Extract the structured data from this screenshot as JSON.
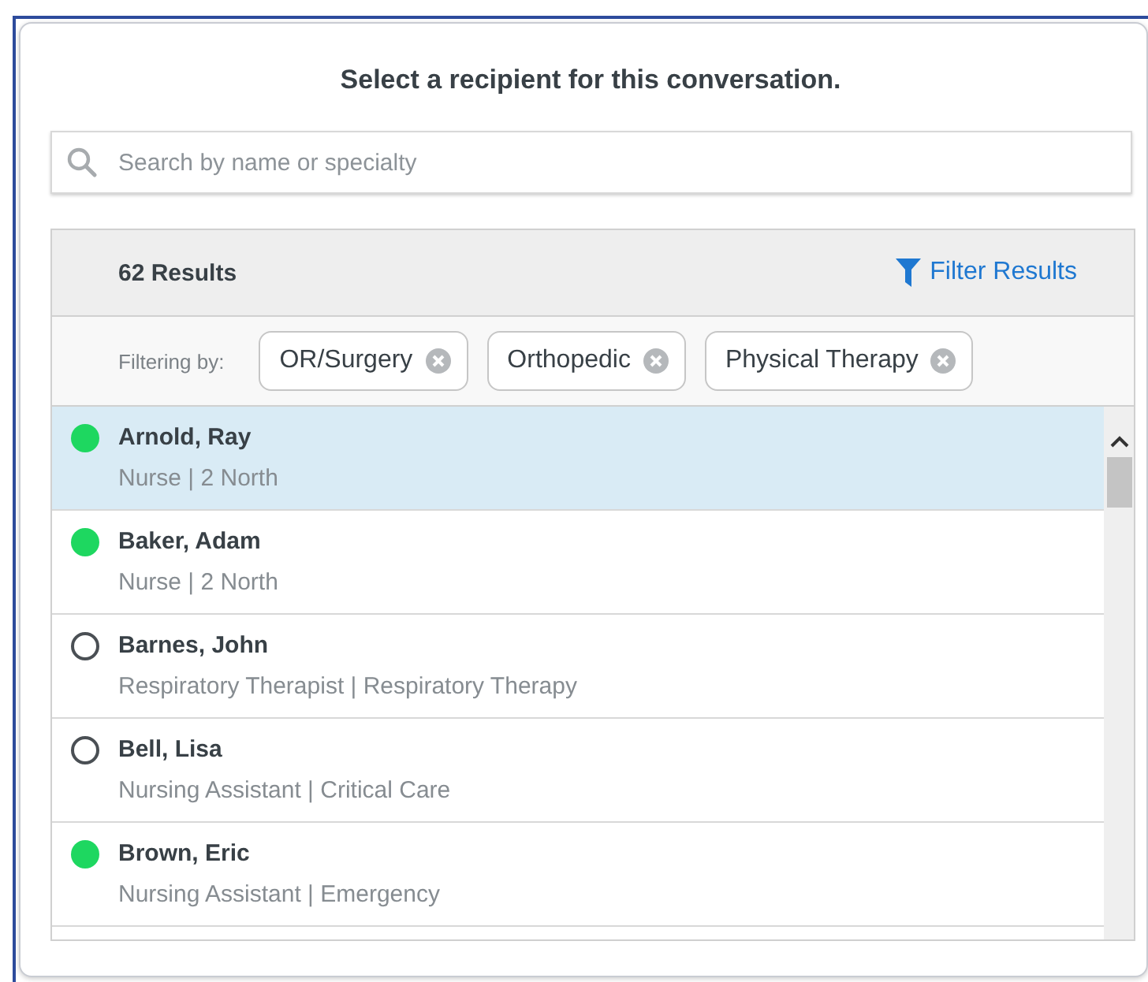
{
  "dialog": {
    "title": "Select a recipient for this conversation."
  },
  "search": {
    "placeholder": "Search by name or specialty"
  },
  "results": {
    "count": "62 Results",
    "filter_button": "Filter Results",
    "filter_label": "Filtering by:",
    "filters": [
      {
        "label": "OR/Surgery"
      },
      {
        "label": "Orthopedic"
      },
      {
        "label": "Physical Therapy"
      }
    ]
  },
  "recipients": [
    {
      "name": "Arnold, Ray",
      "detail": "Nurse | 2 North",
      "online": true,
      "selected": true
    },
    {
      "name": "Baker, Adam",
      "detail": "Nurse | 2 North",
      "online": true,
      "selected": false
    },
    {
      "name": "Barnes, John",
      "detail": "Respiratory Therapist | Respiratory Therapy",
      "online": false,
      "selected": false
    },
    {
      "name": "Bell, Lisa",
      "detail": "Nursing Assistant | Critical Care",
      "online": false,
      "selected": false
    },
    {
      "name": "Brown, Eric",
      "detail": "Nursing Assistant | Emergency",
      "online": true,
      "selected": false
    }
  ]
}
